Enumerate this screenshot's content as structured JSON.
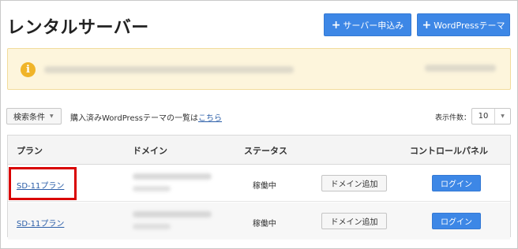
{
  "header": {
    "title": "レンタルサーバー",
    "buttons": [
      {
        "label": "サーバー申込み",
        "icon": "plus-icon"
      },
      {
        "label": "WordPressテーマ",
        "icon": "plus-icon"
      }
    ]
  },
  "notice": {
    "icon": "info-icon",
    "icon_glyph": "i",
    "color": "#f0b429"
  },
  "toolbar": {
    "filter_label": "検索条件",
    "wp_text": "購入済みWordPressテーマの一覧は",
    "wp_link": "こちら",
    "count_label": "表示件数：",
    "count_value": "10"
  },
  "table": {
    "headers": [
      "プラン",
      "ドメイン",
      "ステータス",
      "コントロールパネル"
    ],
    "rows": [
      {
        "plan": "SD-11プラン",
        "status": "稼働中",
        "add_domain": "ドメイン追加",
        "login": "ログイン"
      },
      {
        "plan": "SD-11プラン",
        "status": "稼働中",
        "add_domain": "ドメイン追加",
        "login": "ログイン"
      }
    ]
  },
  "colors": {
    "accent": "#3d87e6",
    "highlight": "#d90000",
    "link": "#2b5ea8"
  }
}
